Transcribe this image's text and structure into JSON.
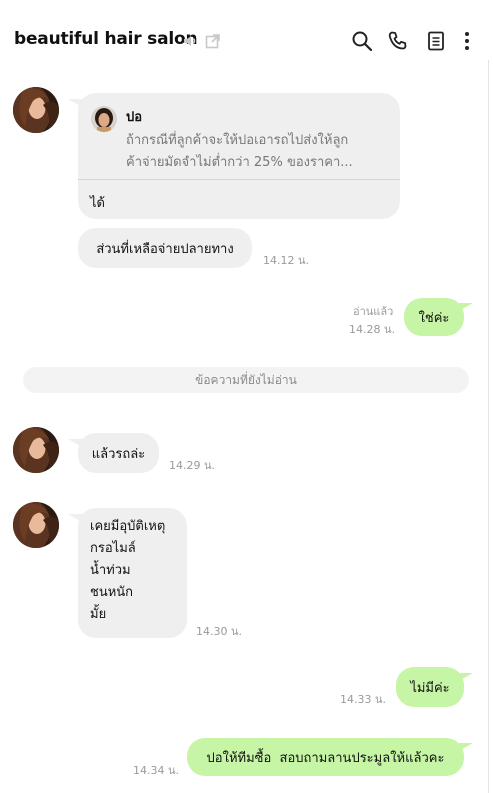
{
  "header": {
    "title": "beautiful hair salon",
    "icons": [
      "speaker-muted-icon",
      "external-link-icon",
      "search-icon",
      "phone-icon",
      "notes-icon",
      "more-vert-icon"
    ]
  },
  "messages": {
    "reply_card": {
      "quoted_sender": "ปอ",
      "quoted_line1": "ถ้ากรณีที่ลูกค้าจะให้ปอเอารถไปส่งให้ลูก",
      "quoted_line2": "ค้าจ่ายมัดจำไม่ต่ำกว่า 25% ของราคา...",
      "reply_text": "ได้"
    },
    "msg2": {
      "text": "ส่วนที่เหลือจ่ายปลายทาง",
      "time": "14.12 น."
    },
    "msg3": {
      "read": "อ่านแล้ว",
      "time": "14.28 น.",
      "text": "ใช่ค่ะ"
    },
    "unread_divider": "ข้อความที่ยังไม่อ่าน",
    "msg4": {
      "text": "แล้วรถล่ะ",
      "time": "14.29 น."
    },
    "msg5": {
      "lines": [
        "เคยมีอุบัติเหตุ",
        "กรอไมล์",
        "น้ำท่วม",
        "ชนหนัก",
        "มั้ย"
      ],
      "time": "14.30 น."
    },
    "msg6": {
      "text": "ไม่มีค่ะ",
      "time": "14.33 น."
    },
    "msg7": {
      "text": "ปอให้ทีมซื้อ  สอบถามลานประมูลให้แล้วคะ",
      "time": "14.34 น."
    }
  },
  "colors": {
    "incoming_bubble": "#efefef",
    "outgoing_bubble": "#c6f5a6",
    "meta_text": "#9a9a9a"
  }
}
